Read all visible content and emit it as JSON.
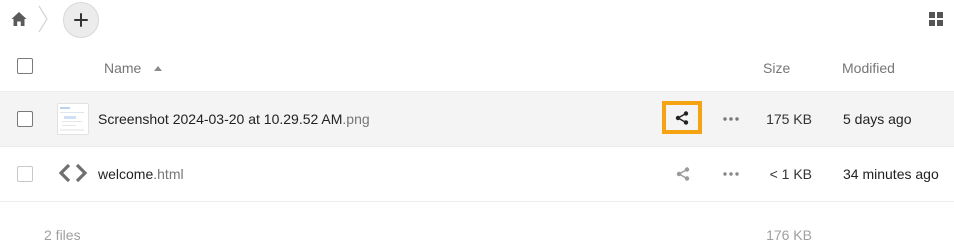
{
  "breadcrumb": {
    "home_icon": "home-icon",
    "separator_icon": "chevron-right-icon"
  },
  "toolbar": {
    "add_icon": "plus-icon",
    "view_toggle_icon": "grid-view-icon"
  },
  "table": {
    "columns": {
      "name": "Name",
      "size": "Size",
      "modified": "Modified"
    },
    "sort": {
      "column": "name",
      "direction": "ascending"
    },
    "rows": [
      {
        "name": "Screenshot 2024-03-20 at 10.29.52 AM",
        "extension": ".png",
        "size": "175 KB",
        "modified": "5 days ago",
        "icon": "image-thumbnail",
        "selected": true,
        "share_highlighted": true
      },
      {
        "name": "welcome",
        "extension": ".html",
        "size": "< 1 KB",
        "modified": "34 minutes ago",
        "icon": "code-file-icon",
        "selected": false,
        "share_highlighted": false
      }
    ]
  },
  "summary": {
    "count": "2 files",
    "total_size": "176 KB"
  },
  "colors": {
    "highlight": "#f6a313",
    "selected_row": "#f4f4f4",
    "muted_text": "#767676"
  }
}
